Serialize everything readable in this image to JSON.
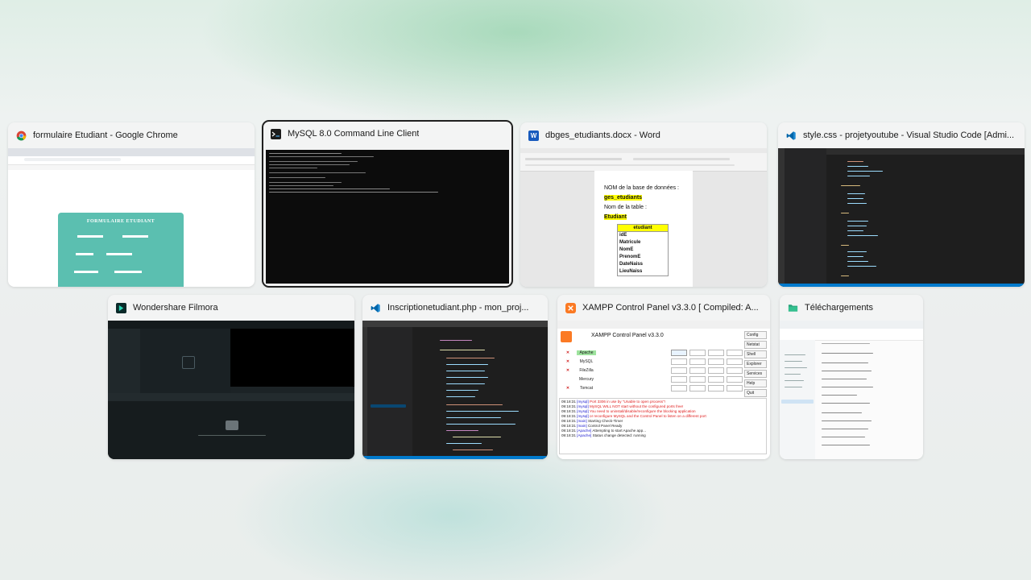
{
  "windows": [
    {
      "title": "formulaire Etudiant - Google Chrome",
      "icon": "chrome-icon",
      "form_title": "FORMULAIRE ETUDIANT"
    },
    {
      "title": "MySQL 8.0 Command Line Client",
      "icon": "mysql-terminal-icon"
    },
    {
      "title": "dbges_etudiants.docx - Word",
      "icon": "word-icon",
      "doc": {
        "db_label": "NOM de la base de données :",
        "db_name": "ges_etudiants",
        "table_label": "Nom de la table :",
        "table_name": "Etudiant",
        "table_header": "etudiant",
        "fields": [
          "idE",
          "Matricule",
          "NomE",
          "PrenomE",
          "DateNaiss",
          "LieuNaiss"
        ]
      }
    },
    {
      "title": "style.css - projetyoutube - Visual Studio Code [Admi...",
      "icon": "vscode-icon"
    },
    {
      "title": "Wondershare Filmora",
      "icon": "filmora-icon"
    },
    {
      "title": "Inscriptionetudiant.php - mon_proj...",
      "icon": "vscode-icon"
    },
    {
      "title": "XAMPP Control Panel v3.3.0   [ Compiled: A...",
      "icon": "xampp-icon",
      "xampp": {
        "panel_title": "XAMPP Control Panel v3.3.0",
        "side_buttons": [
          "Config",
          "Netstat",
          "Shell",
          "Explorer",
          "Services",
          "Help",
          "Quit"
        ],
        "modules": [
          "Apache",
          "MySQL",
          "FileZilla",
          "Mercury",
          "Tomcat"
        ],
        "log": [
          {
            "time": "09:18:31",
            "src": "[mysql]",
            "msg": "Port 3306 in use by \"Unable to open process\"!",
            "color": "#e02020"
          },
          {
            "time": "09:18:31",
            "src": "[mysql]",
            "msg": "MySQL WILL NOT start without the configured ports free!",
            "color": "#e02020"
          },
          {
            "time": "09:18:31",
            "src": "[mysql]",
            "msg": "You need to uninstall/disable/reconfigure the blocking application",
            "color": "#e02020"
          },
          {
            "time": "09:18:31",
            "src": "[mysql]",
            "msg": "or reconfigure MySQL and the Control Panel to listen on a different port",
            "color": "#e02020"
          },
          {
            "time": "09:18:31",
            "src": "[main]",
            "msg": "Starting Check-Timer",
            "color": "#222222"
          },
          {
            "time": "09:18:31",
            "src": "[main]",
            "msg": "Control Panel Ready",
            "color": "#222222"
          },
          {
            "time": "09:18:31",
            "src": "[Apache]",
            "msg": "Attempting to start Apache app...",
            "color": "#222222"
          },
          {
            "time": "09:18:31",
            "src": "[Apache]",
            "msg": "Status change detected: running",
            "color": "#222222"
          }
        ]
      }
    },
    {
      "title": "Téléchargements",
      "icon": "folder-icon"
    }
  ]
}
